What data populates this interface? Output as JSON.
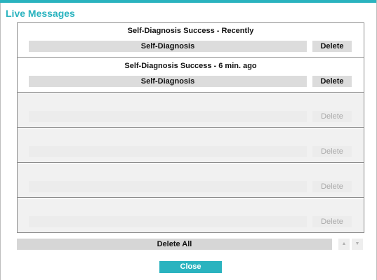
{
  "dialog": {
    "title": "Live Messages",
    "accent_color": "#2ab3bf"
  },
  "messages": [
    {
      "title": "Self-Diagnosis Success - Recently",
      "type": "Self-Diagnosis",
      "delete_label": "Delete",
      "enabled": true
    },
    {
      "title": "Self-Diagnosis Success - 6 min. ago",
      "type": "Self-Diagnosis",
      "delete_label": "Delete",
      "enabled": true
    },
    {
      "title": "",
      "type": "",
      "delete_label": "Delete",
      "enabled": false
    },
    {
      "title": "",
      "type": "",
      "delete_label": "Delete",
      "enabled": false
    },
    {
      "title": "",
      "type": "",
      "delete_label": "Delete",
      "enabled": false
    },
    {
      "title": "",
      "type": "",
      "delete_label": "Delete",
      "enabled": false
    }
  ],
  "footer": {
    "delete_all_label": "Delete All",
    "scroll_up_icon": "triangle-up",
    "scroll_down_icon": "triangle-down",
    "close_label": "Close"
  }
}
